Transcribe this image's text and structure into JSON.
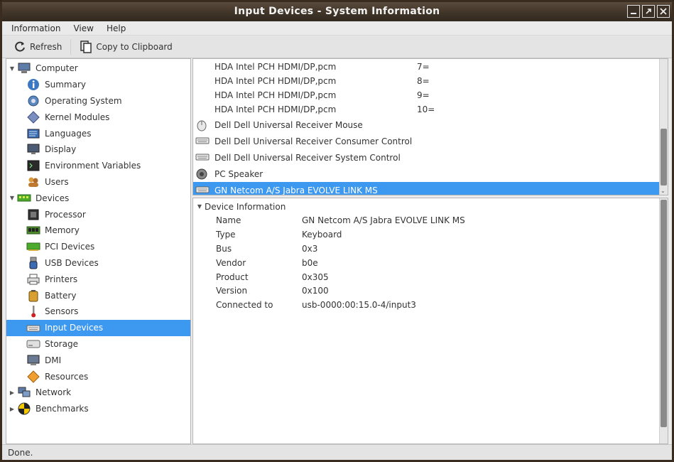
{
  "window": {
    "title": "Input Devices - System Information"
  },
  "menu": {
    "information": "Information",
    "view": "View",
    "help": "Help"
  },
  "toolbar": {
    "refresh": "Refresh",
    "copy": "Copy to Clipboard"
  },
  "sidebar": {
    "computer": "Computer",
    "computer_items": [
      {
        "label": "Summary",
        "icon": "info-icon"
      },
      {
        "label": "Operating System",
        "icon": "gear-icon"
      },
      {
        "label": "Kernel Modules",
        "icon": "module-icon"
      },
      {
        "label": "Languages",
        "icon": "flag-icon"
      },
      {
        "label": "Display",
        "icon": "monitor-icon"
      },
      {
        "label": "Environment Variables",
        "icon": "terminal-icon"
      },
      {
        "label": "Users",
        "icon": "users-icon"
      }
    ],
    "devices": "Devices",
    "device_items": [
      {
        "label": "Processor",
        "icon": "cpu-icon"
      },
      {
        "label": "Memory",
        "icon": "memory-icon"
      },
      {
        "label": "PCI Devices",
        "icon": "pci-icon"
      },
      {
        "label": "USB Devices",
        "icon": "usb-icon"
      },
      {
        "label": "Printers",
        "icon": "printer-icon"
      },
      {
        "label": "Battery",
        "icon": "battery-icon"
      },
      {
        "label": "Sensors",
        "icon": "thermometer-icon"
      },
      {
        "label": "Input Devices",
        "icon": "keyboard-icon"
      },
      {
        "label": "Storage",
        "icon": "storage-icon"
      },
      {
        "label": "DMI",
        "icon": "dmi-icon"
      },
      {
        "label": "Resources",
        "icon": "resources-icon"
      }
    ],
    "network": "Network",
    "benchmarks": "Benchmarks"
  },
  "devices_list": {
    "hda_rows": [
      {
        "name": "HDA Intel PCH HDMI/DP,pcm",
        "value": "7="
      },
      {
        "name": "HDA Intel PCH HDMI/DP,pcm",
        "value": "8="
      },
      {
        "name": "HDA Intel PCH HDMI/DP,pcm",
        "value": "9="
      },
      {
        "name": "HDA Intel PCH HDMI/DP,pcm",
        "value": "10="
      }
    ],
    "devices": [
      {
        "name": "Dell Dell Universal Receiver Mouse",
        "icon": "mouse-icon"
      },
      {
        "name": "Dell Dell Universal Receiver Consumer Control",
        "icon": "keyboard-icon"
      },
      {
        "name": "Dell Dell Universal Receiver System Control",
        "icon": "keyboard-icon"
      },
      {
        "name": "PC Speaker",
        "icon": "speaker-icon"
      },
      {
        "name": "GN Netcom A/S Jabra EVOLVE LINK MS",
        "icon": "keyboard-icon"
      }
    ]
  },
  "detail": {
    "section": "Device Information",
    "rows": [
      {
        "key": "Name",
        "value": "GN Netcom A/S Jabra EVOLVE LINK MS"
      },
      {
        "key": "Type",
        "value": "Keyboard"
      },
      {
        "key": "Bus",
        "value": "0x3"
      },
      {
        "key": "Vendor",
        "value": "b0e"
      },
      {
        "key": "Product",
        "value": "0x305"
      },
      {
        "key": "Version",
        "value": "0x100"
      },
      {
        "key": "Connected to",
        "value": "usb-0000:00:15.0-4/input3"
      }
    ]
  },
  "status": {
    "text": "Done."
  },
  "colors": {
    "selection": "#3d99f0",
    "titlebar": "#3e3327"
  }
}
